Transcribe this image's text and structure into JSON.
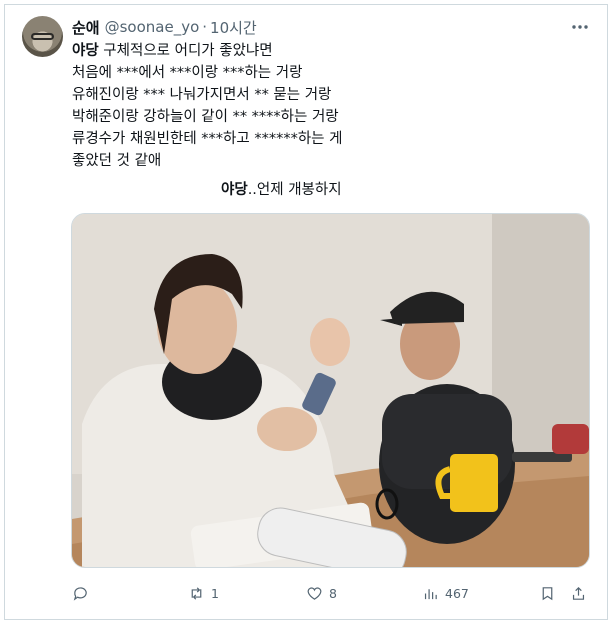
{
  "tweet": {
    "display_name": "순애",
    "handle": "@soonae_yo",
    "separator": "·",
    "time": "10시간",
    "line1_bold": "야당",
    "line1_rest": " 구체적으로 어디가 좋았냐면",
    "lines": "처음에 ***에서 ***이랑 ***하는 거랑\n유해진이랑 *** 나눠가지면서 ** 묻는 거랑\n박해준이랑 강하늘이 같이 ** ****하는 거랑\n류경수가 채원빈한테 ***하고 ******하는 게\n좋았던 것 같애",
    "tail_bold": "야당",
    "tail_rest": "..언제 개봉하지"
  },
  "actions": {
    "reply_count": "",
    "retweet_count": "1",
    "like_count": "8",
    "views_count": "467"
  },
  "icons": [
    "more-icon",
    "reply-icon",
    "retweet-icon",
    "like-icon",
    "views-icon",
    "bookmark-icon",
    "share-icon"
  ],
  "colors": {
    "text": "#0f1419",
    "muted": "#536471",
    "border": "#cfd9de"
  }
}
